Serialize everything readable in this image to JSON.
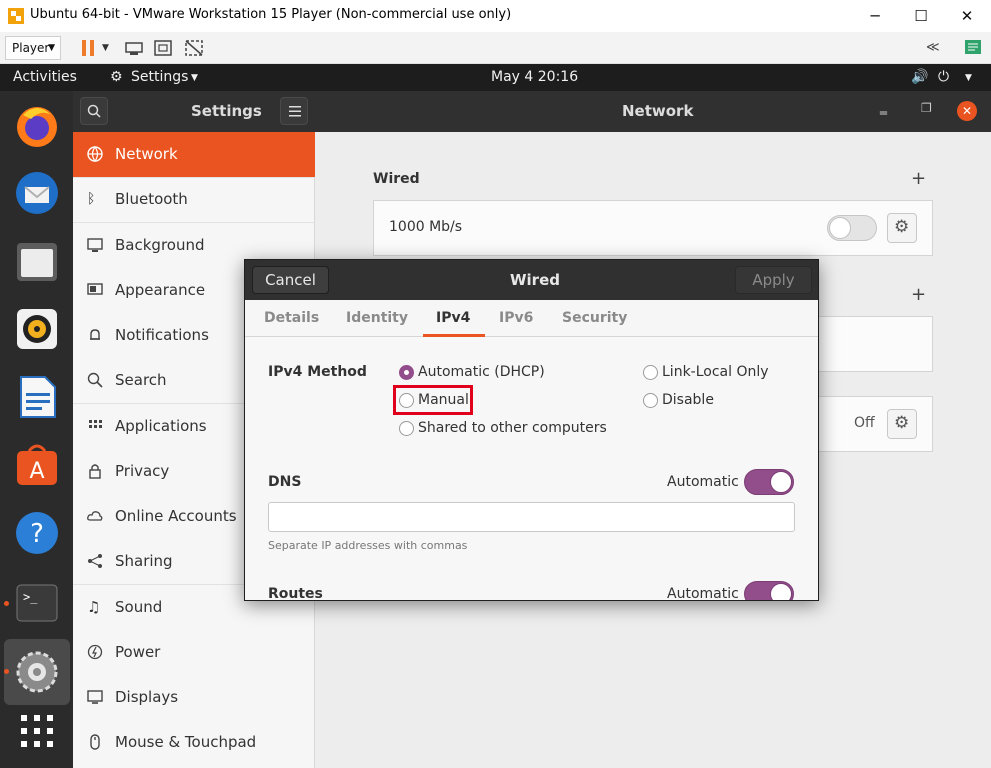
{
  "vm": {
    "title": "Ubuntu 64-bit - VMware Workstation 15 Player (Non-commercial use only)",
    "player_menu": "Player",
    "minimize": "─",
    "maximize": "☐",
    "close": "✕"
  },
  "topbar": {
    "activities": "Activities",
    "app_menu": "Settings",
    "clock": "May 4  20:16"
  },
  "dock": {
    "apps": [
      "firefox-icon",
      "thunderbird-icon",
      "files-icon",
      "rhythmbox-icon",
      "writer-icon",
      "software-icon",
      "help-icon",
      "terminal-icon",
      "settings-icon",
      "show-apps-icon"
    ]
  },
  "settings": {
    "sidebar_title": "Settings",
    "page_title": "Network",
    "items": [
      {
        "label": "Network",
        "icon": "network-icon",
        "selected": true
      },
      {
        "label": "Bluetooth",
        "icon": "bluetooth-icon"
      },
      {
        "label": "Background",
        "icon": "background-icon"
      },
      {
        "label": "Appearance",
        "icon": "appearance-icon"
      },
      {
        "label": "Notifications",
        "icon": "bell-icon"
      },
      {
        "label": "Search",
        "icon": "search-icon"
      },
      {
        "label": "Applications",
        "icon": "applications-icon"
      },
      {
        "label": "Privacy",
        "icon": "lock-icon"
      },
      {
        "label": "Online Accounts",
        "icon": "cloud-icon"
      },
      {
        "label": "Sharing",
        "icon": "share-icon"
      },
      {
        "label": "Sound",
        "icon": "music-note-icon"
      },
      {
        "label": "Power",
        "icon": "power-icon"
      },
      {
        "label": "Displays",
        "icon": "display-icon"
      },
      {
        "label": "Mouse & Touchpad",
        "icon": "mouse-icon"
      }
    ]
  },
  "network": {
    "wired_heading": "Wired",
    "wired_speed": "1000 Mb/s",
    "vpn_status": "Off"
  },
  "dialog": {
    "title": "Wired",
    "cancel": "Cancel",
    "apply": "Apply",
    "tabs": [
      "Details",
      "Identity",
      "IPv4",
      "IPv6",
      "Security"
    ],
    "active_tab": "IPv4",
    "ipv4_method_label": "IPv4 Method",
    "methods": {
      "automatic": "Automatic (DHCP)",
      "manual": "Manual",
      "shared": "Shared to other computers",
      "link_local": "Link-Local Only",
      "disable": "Disable"
    },
    "selected_method": "Automatic (DHCP)",
    "dns_label": "DNS",
    "dns_automatic": "Automatic",
    "dns_value": "",
    "dns_hint": "Separate IP addresses with commas",
    "routes_label": "Routes",
    "routes_automatic": "Automatic"
  },
  "colors": {
    "accent": "#e95420",
    "toggle_on": "#924d8b",
    "highlight_box": "#e0001b"
  }
}
